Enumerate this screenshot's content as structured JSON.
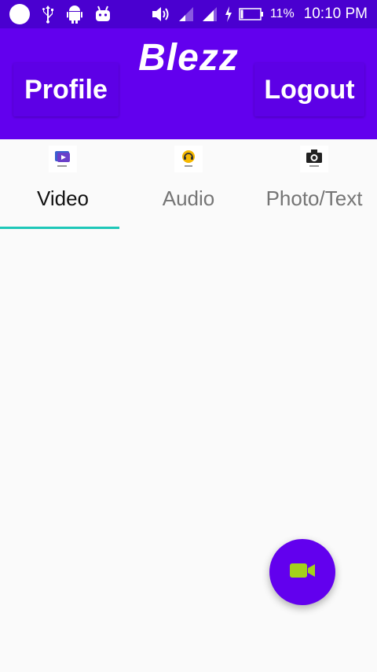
{
  "status_bar": {
    "battery": "11%",
    "time": "10:10 PM",
    "icons": [
      "circle-icon",
      "usb-icon",
      "android-icon",
      "android-debug-icon",
      "volume-icon",
      "signal-icon",
      "signal-icon",
      "charging-icon",
      "battery-icon"
    ]
  },
  "app_bar": {
    "title": "Blezz",
    "profile_label": "Profile",
    "logout_label": "Logout"
  },
  "tabs": [
    {
      "label": "Video",
      "icon": "video-thumbnail-icon",
      "active": true
    },
    {
      "label": "Audio",
      "icon": "audio-thumbnail-icon",
      "active": false
    },
    {
      "label": "Photo/Text",
      "icon": "photo-thumbnail-icon",
      "active": false
    }
  ],
  "fab": {
    "icon": "video-camera-icon"
  },
  "colors": {
    "status_bar": "#4a00d0",
    "primary": "#6200ee",
    "tab_indicator": "#1ec7b8",
    "fab_icon": "#a4d11a"
  }
}
